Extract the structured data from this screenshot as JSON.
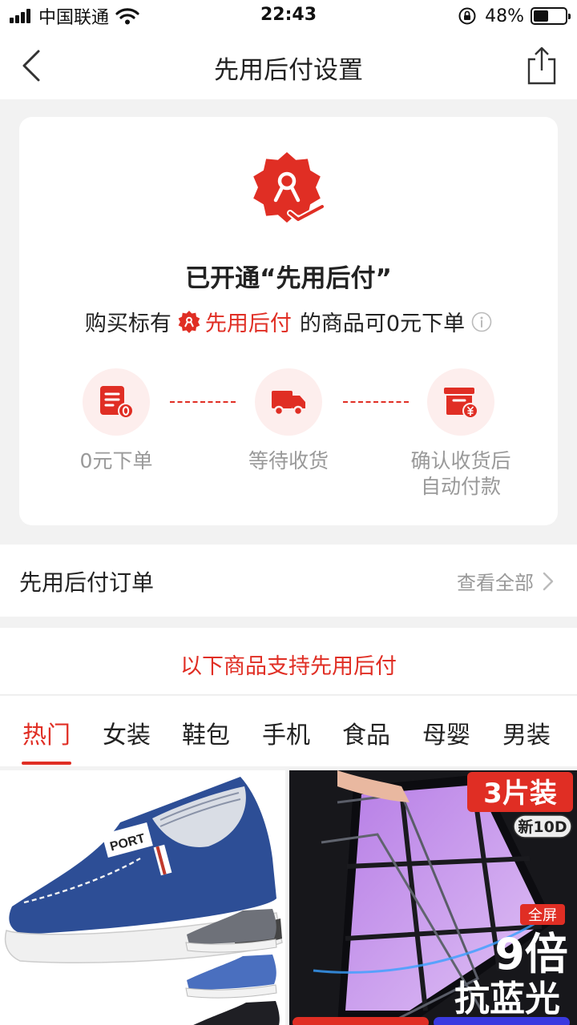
{
  "status_bar": {
    "carrier": "中国联通",
    "time": "22:43",
    "battery_percent": "48%",
    "battery_level": 0.48
  },
  "nav": {
    "title": "先用后付设置",
    "back_icon": "chevron-left-icon",
    "share_icon": "share-icon"
  },
  "status_card": {
    "title": "已开通“先用后付”",
    "subtitle_prefix": "购买标有",
    "subtitle_highlight": "先用后付",
    "subtitle_suffix": "的商品可0元下单",
    "accent_color": "#e02e24",
    "steps": [
      {
        "icon": "order-document-icon",
        "label": "0元下单"
      },
      {
        "icon": "delivery-truck-icon",
        "label": "等待收货"
      },
      {
        "icon": "payment-box-icon",
        "label": "确认收货后\n自动付款"
      }
    ]
  },
  "orders": {
    "title": "先用后付订单",
    "view_all": "查看全部"
  },
  "products_section": {
    "title": "以下商品支持先用后付",
    "tabs": [
      "热门",
      "女装",
      "鞋包",
      "手机",
      "食品",
      "母婴",
      "男装"
    ],
    "active_tab": 0
  },
  "products": [
    {
      "image": "blue-canvas-shoes",
      "shoe_text": "PORT"
    },
    {
      "image": "screen-protector-glass",
      "tag_pack": "3片装",
      "tag_model": "新10D",
      "tag_full": "全屏",
      "promo_line1": "9倍",
      "promo_line2": "抗蓝光"
    }
  ]
}
